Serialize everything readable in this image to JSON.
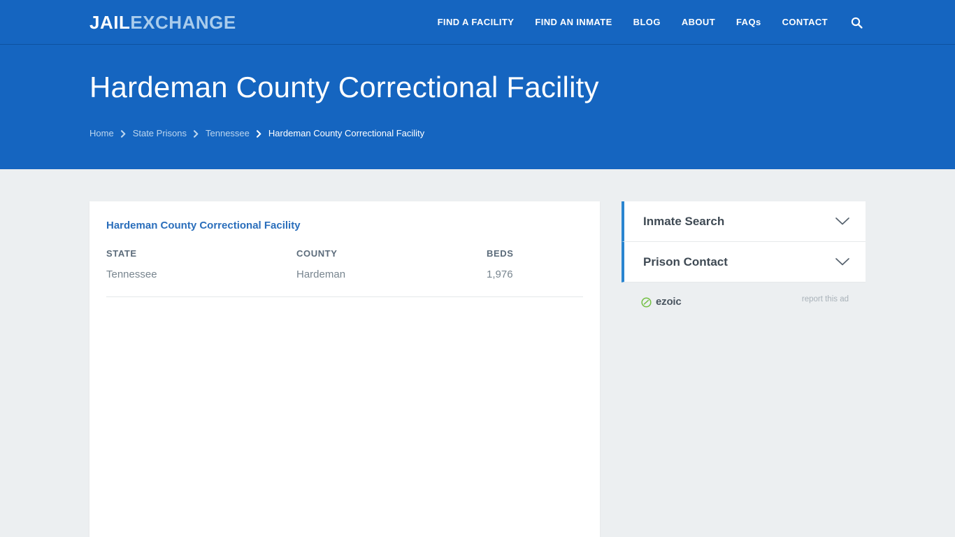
{
  "site": {
    "logo_primary": "JAIL",
    "logo_secondary": "EXCHANGE",
    "brand_blue": "#1565c0",
    "accent_blue": "#2a85d0",
    "body_bg": "#eceff1"
  },
  "nav": {
    "items": [
      {
        "label": "FIND A FACILITY"
      },
      {
        "label": "FIND AN INMATE"
      },
      {
        "label": "BLOG"
      },
      {
        "label": "ABOUT"
      },
      {
        "label": "FAQs"
      },
      {
        "label": "CONTACT"
      }
    ],
    "search_icon": "search-icon"
  },
  "hero": {
    "title": "Hardeman County Correctional Facility",
    "breadcrumb": [
      {
        "label": "Home",
        "current": false
      },
      {
        "label": "State Prisons",
        "current": false
      },
      {
        "label": "Tennessee",
        "current": false
      },
      {
        "label": "Hardeman County Correctional Facility",
        "current": true
      }
    ]
  },
  "main": {
    "card_heading": "Hardeman County Correctional Facility",
    "facts": [
      {
        "label": "STATE",
        "value": "Tennessee"
      },
      {
        "label": "COUNTY",
        "value": "Hardeman"
      },
      {
        "label": "BEDS",
        "value": "1,976"
      }
    ]
  },
  "sidebar": {
    "accordions": [
      {
        "title": "Inmate Search",
        "icon": "chevron-down-icon"
      },
      {
        "title": "Prison Contact",
        "icon": "chevron-down-icon"
      }
    ],
    "ad": {
      "provider": "ezoic",
      "report_label": "report this ad"
    }
  }
}
